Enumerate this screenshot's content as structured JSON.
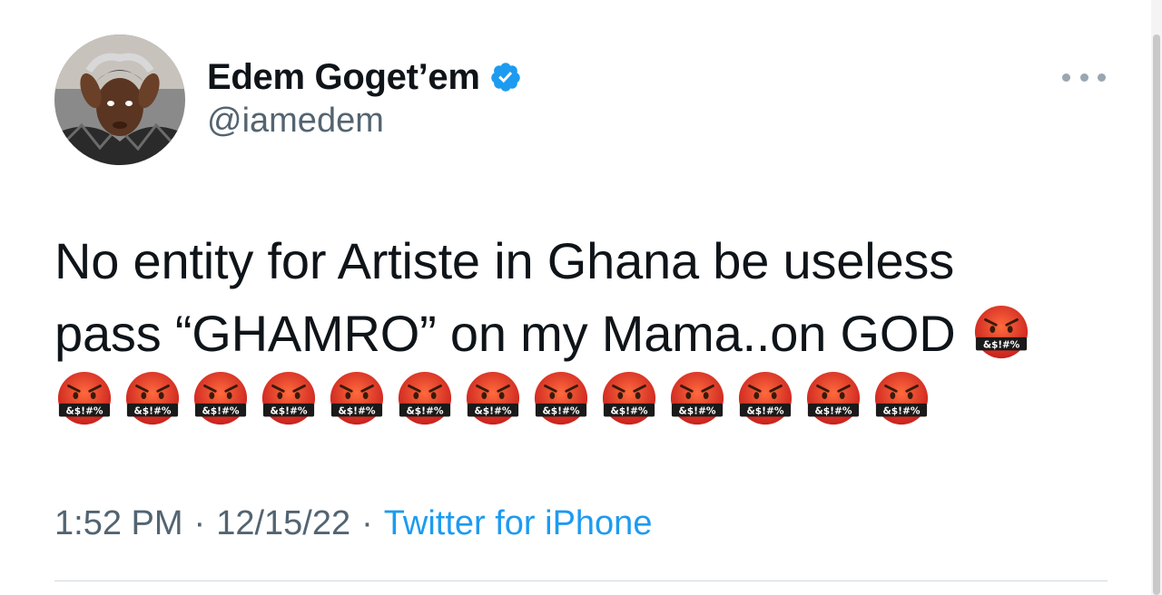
{
  "author": {
    "display_name": "Edem Goget’em",
    "handle": "@iamedem",
    "verified": true
  },
  "tweet": {
    "line1": "No entity for Artiste in Ghana be useless",
    "line2": "pass “GHAMRO” on my Mama..on GOD",
    "emoji_name": "face-with-symbols-on-mouth",
    "emoji_symbols": "&$!#%",
    "emoji_count_total": 14
  },
  "meta": {
    "time": "1:52 PM",
    "separator": "·",
    "date": "12/15/22",
    "source": "Twitter for iPhone"
  },
  "colors": {
    "text": "#0f1419",
    "secondary": "#536471",
    "accent": "#1d9bf0",
    "divider": "#cfd9de"
  },
  "icons": {
    "verified": "verified-badge-icon",
    "more": "more-options-icon"
  }
}
